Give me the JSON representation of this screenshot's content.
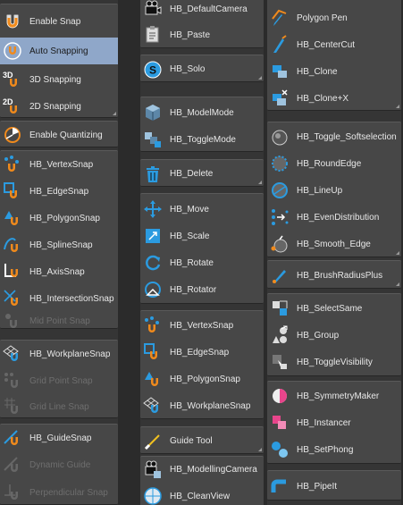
{
  "col1": {
    "items": [
      {
        "label": "Enable Snap",
        "icon": "magnet-icon"
      },
      {
        "label": "Auto Snapping",
        "icon": "auto-snap-icon",
        "active": true
      },
      {
        "label": "3D Snapping",
        "icon": "3d-snap-icon",
        "prefix": "3D"
      },
      {
        "label": "2D Snapping",
        "icon": "2d-snap-icon",
        "prefix": "2D"
      },
      {
        "label": "Enable Quantizing",
        "icon": "quantize-icon"
      },
      {
        "label": "HB_VertexSnap",
        "icon": "vertex-snap-icon"
      },
      {
        "label": "HB_EdgeSnap",
        "icon": "edge-snap-icon"
      },
      {
        "label": "HB_PolygonSnap",
        "icon": "polygon-snap-icon"
      },
      {
        "label": "HB_SplineSnap",
        "icon": "spline-snap-icon"
      },
      {
        "label": "HB_AxisSnap",
        "icon": "axis-snap-icon"
      },
      {
        "label": "HB_IntersectionSnap",
        "icon": "intersection-snap-icon"
      },
      {
        "label": "Mid Point Snap",
        "icon": "mid-point-snap-icon",
        "disabled": true
      },
      {
        "label": "HB_WorkplaneSnap",
        "icon": "workplane-snap-icon"
      },
      {
        "label": "Grid Point Snap",
        "icon": "grid-point-snap-icon",
        "disabled": true
      },
      {
        "label": "Grid Line Snap",
        "icon": "grid-line-snap-icon",
        "disabled": true
      },
      {
        "label": "HB_GuideSnap",
        "icon": "guide-snap-icon"
      },
      {
        "label": "Dynamic Guide",
        "icon": "dynamic-guide-icon",
        "disabled": true
      },
      {
        "label": "Perpendicular Snap",
        "icon": "perpendicular-snap-icon",
        "disabled": true
      }
    ]
  },
  "col2": {
    "items": [
      {
        "label": "HB_DefaultCamera",
        "icon": "camera-icon"
      },
      {
        "label": "HB_Paste",
        "icon": "paste-icon"
      },
      {
        "label": "HB_Solo",
        "icon": "solo-icon"
      },
      {
        "label": "HB_ModelMode",
        "icon": "cube-icon"
      },
      {
        "label": "HB_ToggleMode",
        "icon": "toggle-mode-icon"
      },
      {
        "label": "HB_Delete",
        "icon": "trash-icon"
      },
      {
        "label": "HB_Move",
        "icon": "move-icon"
      },
      {
        "label": "HB_Scale",
        "icon": "scale-icon"
      },
      {
        "label": "HB_Rotate",
        "icon": "rotate-icon"
      },
      {
        "label": "HB_Rotator",
        "icon": "rotator-icon"
      },
      {
        "label": "HB_VertexSnap",
        "icon": "vertex-snap-icon"
      },
      {
        "label": "HB_EdgeSnap",
        "icon": "edge-snap-icon"
      },
      {
        "label": "HB_PolygonSnap",
        "icon": "polygon-snap-icon"
      },
      {
        "label": "HB_WorkplaneSnap",
        "icon": "workplane-snap-icon"
      },
      {
        "label": "Guide Tool",
        "icon": "guide-tool-icon"
      },
      {
        "label": "HB_ModellingCamera",
        "icon": "modelling-camera-icon"
      },
      {
        "label": "HB_CleanView",
        "icon": "clean-view-icon"
      }
    ]
  },
  "col3": {
    "items": [
      {
        "label": "Polygon Pen",
        "icon": "polygon-pen-icon"
      },
      {
        "label": "HB_CenterCut",
        "icon": "knife-icon"
      },
      {
        "label": "HB_Clone",
        "icon": "clone-icon"
      },
      {
        "label": "HB_Clone+X",
        "icon": "clone-x-icon"
      },
      {
        "label": "HB_Toggle_Softselection",
        "icon": "soft-selection-icon"
      },
      {
        "label": "HB_RoundEdge",
        "icon": "round-edge-icon"
      },
      {
        "label": "HB_LineUp",
        "icon": "line-up-icon"
      },
      {
        "label": "HB_EvenDistribution",
        "icon": "even-distribution-icon"
      },
      {
        "label": "HB_Smooth_Edge",
        "icon": "smooth-edge-icon"
      },
      {
        "label": "HB_BrushRadiusPlus",
        "icon": "brush-radius-icon"
      },
      {
        "label": "HB_SelectSame",
        "icon": "select-same-icon"
      },
      {
        "label": "HB_Group",
        "icon": "group-icon"
      },
      {
        "label": "HB_ToggleVisibility",
        "icon": "toggle-visibility-icon"
      },
      {
        "label": "HB_SymmetryMaker",
        "icon": "symmetry-icon"
      },
      {
        "label": "HB_Instancer",
        "icon": "instancer-icon"
      },
      {
        "label": "HB_SetPhong",
        "icon": "phong-icon"
      },
      {
        "label": "HB_PipeIt",
        "icon": "pipe-icon"
      }
    ]
  },
  "colors": {
    "panel": "#474747",
    "active": "#8fa7c9",
    "disabled_text": "#6e6e6e",
    "accent_blue": "#2b9be0",
    "magnet_orange": "#f08a1c"
  }
}
